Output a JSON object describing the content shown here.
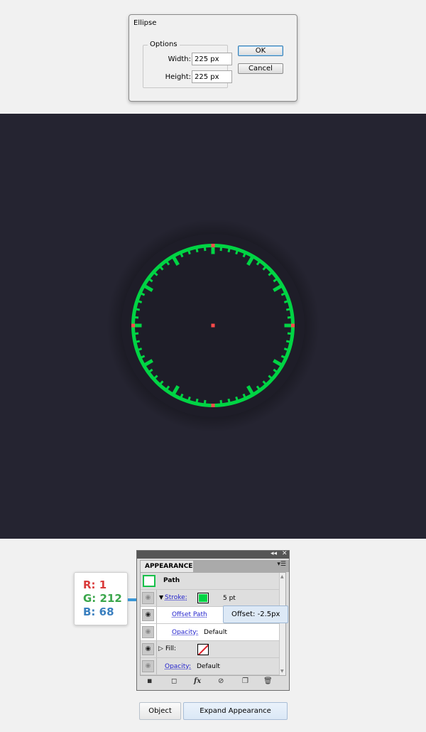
{
  "dialog": {
    "title": "Ellipse",
    "group_label": "Options",
    "width_label": "Width:",
    "width_value": "225 px",
    "height_label": "Height:",
    "height_value": "225 px",
    "ok_label": "OK",
    "cancel_label": "Cancel"
  },
  "canvas": {
    "background": "#252431",
    "bezel_color": "#1e1d28",
    "stroke_color": "#01d444",
    "anchor_color": "#ff4a4a"
  },
  "panel": {
    "tab_label": "APPEARANCE",
    "top_controls": "◂◂",
    "close_control": "✕",
    "menu_icon": "hamburger-icon",
    "rows": {
      "path": "Path",
      "stroke_label": "Stroke:",
      "stroke_weight": "5 pt",
      "offset_path": "Offset Path",
      "opacity_label": "Opacity:",
      "opacity_value": "Default",
      "fill_label": "Fill:",
      "opacity2_label": "Opacity:",
      "opacity2_value": "Default"
    },
    "footer_icons": [
      "new-stroke-icon",
      "new-fill-icon",
      "fx-icon",
      "clear-icon",
      "duplicate-icon",
      "trash-icon"
    ],
    "fx_label": "fx"
  },
  "tooltip": {
    "text": "Offset: -2.5px"
  },
  "color_readout": {
    "r": "R: 1",
    "g": "G: 212",
    "b": "B: 68",
    "r_color": "#d93a3a",
    "g_color": "#3aa64a",
    "b_color": "#3a7fbf"
  },
  "buttons": {
    "object": "Object",
    "expand": "Expand Appearance"
  }
}
